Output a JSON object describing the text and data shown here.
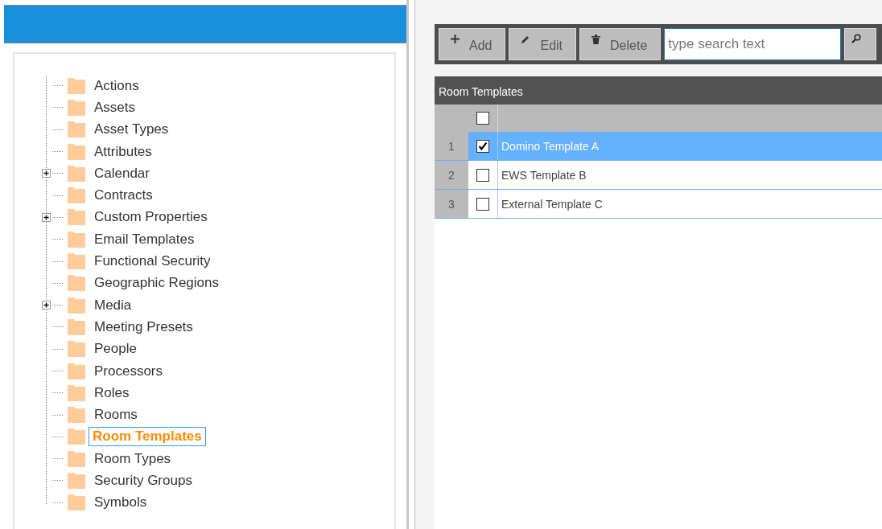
{
  "tree": {
    "items": [
      {
        "label": "Actions",
        "selected": false
      },
      {
        "label": "Assets",
        "selected": false
      },
      {
        "label": "Asset Types",
        "selected": false
      },
      {
        "label": "Attributes",
        "selected": false
      },
      {
        "label": "Calendar",
        "selected": false,
        "expanded": false
      },
      {
        "label": "Contracts",
        "selected": false
      },
      {
        "label": "Custom Properties",
        "selected": false,
        "expanded": false
      },
      {
        "label": "Email Templates",
        "selected": false
      },
      {
        "label": "Functional Security",
        "selected": false
      },
      {
        "label": "Geographic Regions",
        "selected": false
      },
      {
        "label": "Media",
        "selected": false,
        "expanded": false
      },
      {
        "label": "Meeting Presets",
        "selected": false
      },
      {
        "label": "People",
        "selected": false
      },
      {
        "label": "Processors",
        "selected": false
      },
      {
        "label": "Roles",
        "selected": false
      },
      {
        "label": "Rooms",
        "selected": false
      },
      {
        "label": "Room Templates",
        "selected": true
      },
      {
        "label": "Room Types",
        "selected": false
      },
      {
        "label": "Security Groups",
        "selected": false
      },
      {
        "label": "Symbols",
        "selected": false
      }
    ]
  },
  "toolbar": {
    "buttons": [
      {
        "kind": "add",
        "label": "Add"
      },
      {
        "kind": "edit",
        "label": "Edit"
      },
      {
        "kind": "delete",
        "label": "Delete"
      }
    ],
    "search": {
      "placeholder": "type search text"
    }
  },
  "grid": {
    "title": "Room Templates",
    "header_checked": false,
    "rows": [
      {
        "number": "1",
        "checked": true,
        "selected": true,
        "name": "Domino Template A"
      },
      {
        "number": "2",
        "checked": false,
        "selected": false,
        "name": "EWS Template B"
      },
      {
        "number": "3",
        "checked": false,
        "selected": false,
        "name": "External Template C"
      }
    ]
  }
}
